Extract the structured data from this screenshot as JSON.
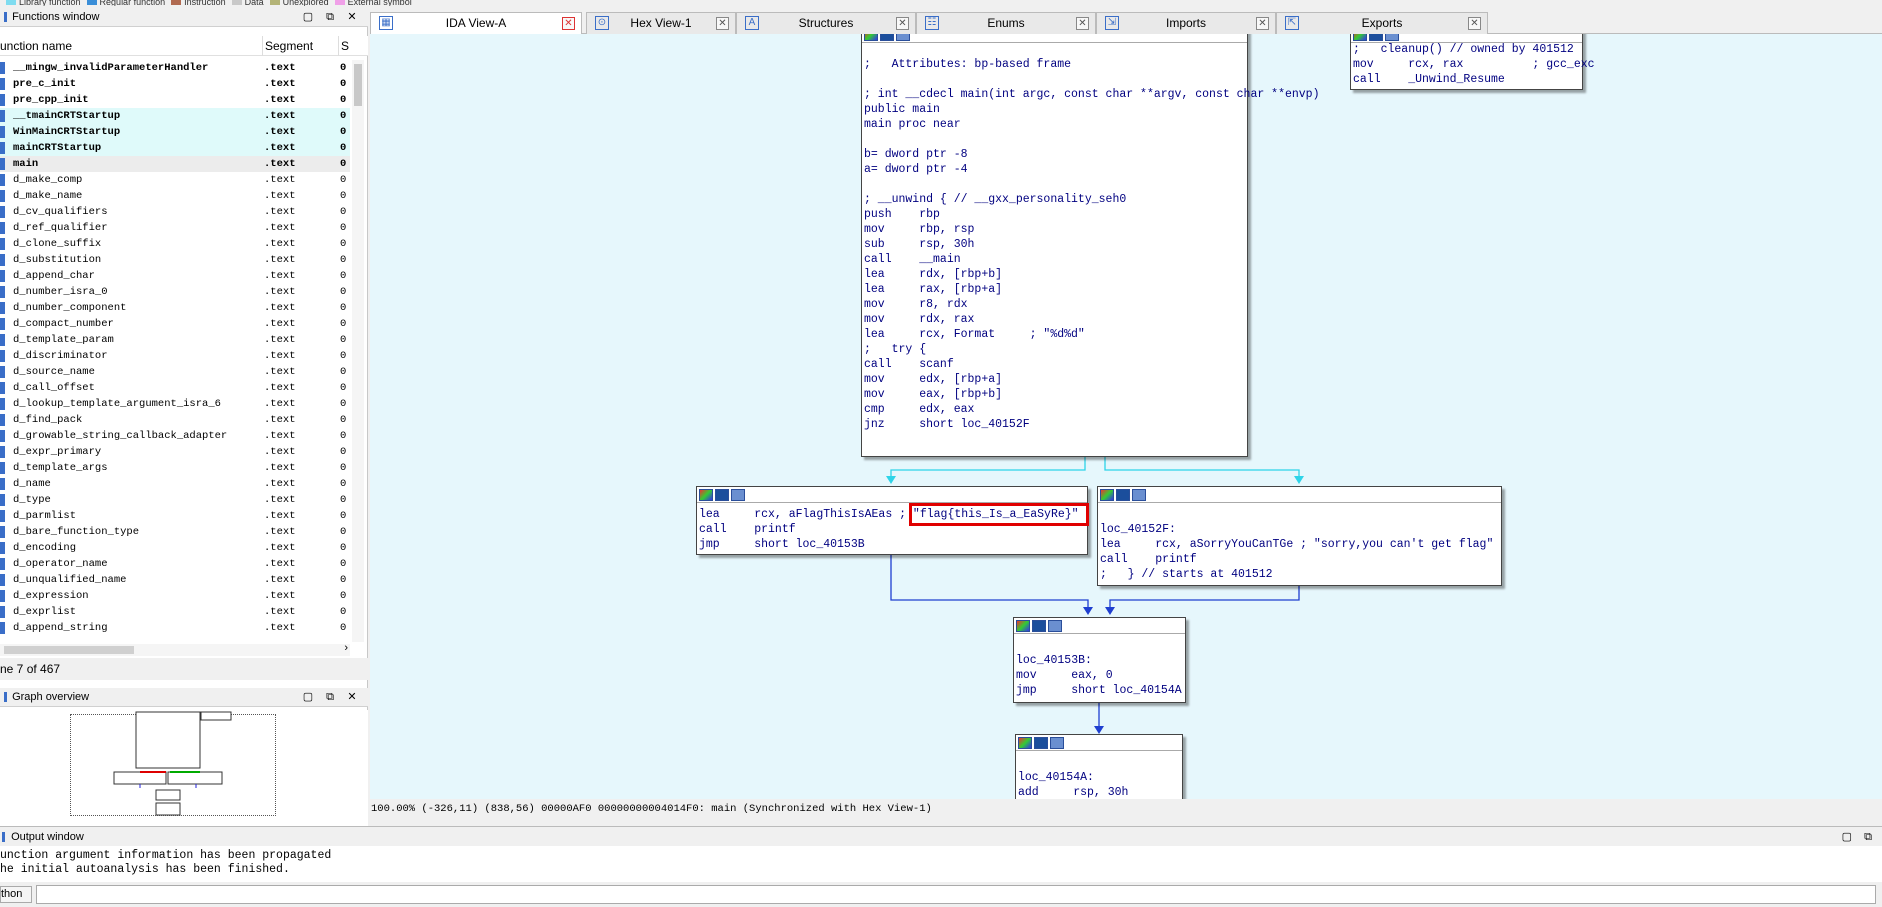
{
  "legend": [
    {
      "label": "Library function",
      "color": "#7fdcf0"
    },
    {
      "label": "Regular function",
      "color": "#3a8ed8"
    },
    {
      "label": "Instruction",
      "color": "#b06a50"
    },
    {
      "label": "Data",
      "color": "#c8c8c8"
    },
    {
      "label": "Unexplored",
      "color": "#b4b478"
    },
    {
      "label": "External symbol",
      "color": "#f0a0e8"
    }
  ],
  "functions_window": {
    "title": "Functions window",
    "columns": {
      "name": "unction name",
      "segment": "Segment",
      "start": "S"
    },
    "rows": [
      {
        "name": "__mingw_invalidParameterHandler",
        "seg": ".text",
        "start": "0",
        "style": "bold"
      },
      {
        "name": "pre_c_init",
        "seg": ".text",
        "start": "0",
        "style": "bold"
      },
      {
        "name": "pre_cpp_init",
        "seg": ".text",
        "start": "0",
        "style": "bold"
      },
      {
        "name": "__tmainCRTStartup",
        "seg": ".text",
        "start": "0",
        "style": "bold hl"
      },
      {
        "name": "WinMainCRTStartup",
        "seg": ".text",
        "start": "0",
        "style": "bold hl"
      },
      {
        "name": "mainCRTStartup",
        "seg": ".text",
        "start": "0",
        "style": "bold hl"
      },
      {
        "name": "main",
        "seg": ".text",
        "start": "0",
        "style": "bold sel"
      },
      {
        "name": "d_make_comp",
        "seg": ".text",
        "start": "0",
        "style": ""
      },
      {
        "name": "d_make_name",
        "seg": ".text",
        "start": "0",
        "style": ""
      },
      {
        "name": "d_cv_qualifiers",
        "seg": ".text",
        "start": "0",
        "style": ""
      },
      {
        "name": "d_ref_qualifier",
        "seg": ".text",
        "start": "0",
        "style": ""
      },
      {
        "name": "d_clone_suffix",
        "seg": ".text",
        "start": "0",
        "style": ""
      },
      {
        "name": "d_substitution",
        "seg": ".text",
        "start": "0",
        "style": ""
      },
      {
        "name": "d_append_char",
        "seg": ".text",
        "start": "0",
        "style": ""
      },
      {
        "name": "d_number_isra_0",
        "seg": ".text",
        "start": "0",
        "style": ""
      },
      {
        "name": "d_number_component",
        "seg": ".text",
        "start": "0",
        "style": ""
      },
      {
        "name": "d_compact_number",
        "seg": ".text",
        "start": "0",
        "style": ""
      },
      {
        "name": "d_template_param",
        "seg": ".text",
        "start": "0",
        "style": ""
      },
      {
        "name": "d_discriminator",
        "seg": ".text",
        "start": "0",
        "style": ""
      },
      {
        "name": "d_source_name",
        "seg": ".text",
        "start": "0",
        "style": ""
      },
      {
        "name": "d_call_offset",
        "seg": ".text",
        "start": "0",
        "style": ""
      },
      {
        "name": "d_lookup_template_argument_isra_6",
        "seg": ".text",
        "start": "0",
        "style": ""
      },
      {
        "name": "d_find_pack",
        "seg": ".text",
        "start": "0",
        "style": ""
      },
      {
        "name": "d_growable_string_callback_adapter",
        "seg": ".text",
        "start": "0",
        "style": ""
      },
      {
        "name": "d_expr_primary",
        "seg": ".text",
        "start": "0",
        "style": ""
      },
      {
        "name": "d_template_args",
        "seg": ".text",
        "start": "0",
        "style": ""
      },
      {
        "name": "d_name",
        "seg": ".text",
        "start": "0",
        "style": ""
      },
      {
        "name": "d_type",
        "seg": ".text",
        "start": "0",
        "style": ""
      },
      {
        "name": "d_parmlist",
        "seg": ".text",
        "start": "0",
        "style": ""
      },
      {
        "name": "d_bare_function_type",
        "seg": ".text",
        "start": "0",
        "style": ""
      },
      {
        "name": "d_encoding",
        "seg": ".text",
        "start": "0",
        "style": ""
      },
      {
        "name": "d_operator_name",
        "seg": ".text",
        "start": "0",
        "style": ""
      },
      {
        "name": "d_unqualified_name",
        "seg": ".text",
        "start": "0",
        "style": ""
      },
      {
        "name": "d_expression",
        "seg": ".text",
        "start": "0",
        "style": ""
      },
      {
        "name": "d_exprlist",
        "seg": ".text",
        "start": "0",
        "style": ""
      },
      {
        "name": "d_append_string",
        "seg": ".text",
        "start": "0",
        "style": ""
      }
    ],
    "line_status": "ne 7 of 467"
  },
  "graph_overview": {
    "title": "Graph overview"
  },
  "tabs": [
    {
      "label": "IDA View-A",
      "icon": "ida-view-icon",
      "active": true
    },
    {
      "label": "Hex View-1",
      "icon": "hex-view-icon",
      "active": false
    },
    {
      "label": "Structures",
      "icon": "structures-icon",
      "active": false
    },
    {
      "label": "Enums",
      "icon": "enums-icon",
      "active": false
    },
    {
      "label": "Imports",
      "icon": "imports-icon",
      "active": false
    },
    {
      "label": "Exports",
      "icon": "exports-icon",
      "active": false
    }
  ],
  "graph": {
    "main_block": [
      ";   Attributes: bp-based frame",
      "",
      "; int __cdecl main(int argc, const char **argv, const char **envp)",
      "public main",
      "main proc near",
      "",
      "b= dword ptr -8",
      "a= dword ptr -4",
      "",
      "; __unwind { // __gxx_personality_seh0",
      "push    rbp",
      "mov     rbp, rsp",
      "sub     rsp, 30h",
      "call    __main",
      "lea     rdx, [rbp+b]",
      "lea     rax, [rbp+a]",
      "mov     r8, rdx",
      "mov     rdx, rax",
      "lea     rcx, Format     ; \"%d%d\"",
      ";   try {",
      "call    scanf",
      "mov     edx, [rbp+a]",
      "mov     eax, [rbp+b]",
      "cmp     edx, eax",
      "jnz     short loc_40152F"
    ],
    "cleanup_block": [
      ";   cleanup() // owned by 401512",
      "mov     rcx, rax          ; gcc_exc",
      "call    _Unwind_Resume"
    ],
    "flag_block": [
      "lea     rcx, aFlagThisIsAEas ; \"flag{this_Is_a_EaSyRe}\"",
      "call    printf",
      "jmp     short loc_40153B"
    ],
    "sorry_block": [
      "",
      "loc_40152F:",
      "lea     rcx, aSorryYouCanTGe ; \"sorry,you can't get flag\"",
      "call    printf",
      ";   } // starts at 401512"
    ],
    "loc_40153B_block": [
      "",
      "loc_40153B:",
      "mov     eax, 0",
      "jmp     short loc_40154A"
    ],
    "loc_40154A_block": [
      "",
      "loc_40154A:",
      "add     rsp, 30h"
    ]
  },
  "status_bar": "100.00% (-326,11) (838,56) 00000AF0 00000000004014F0: main (Synchronized with Hex View-1)",
  "output_window": {
    "title": "Output window",
    "lines": [
      "unction argument information has been propagated",
      "he initial autoanalysis has been finished."
    ],
    "python_label": "thon"
  },
  "colors": {
    "graph_bg": "#e6f7fc",
    "edge_blue": "#1f3fd0",
    "edge_cyan": "#2ed4e8",
    "highlight": "#e00000"
  }
}
